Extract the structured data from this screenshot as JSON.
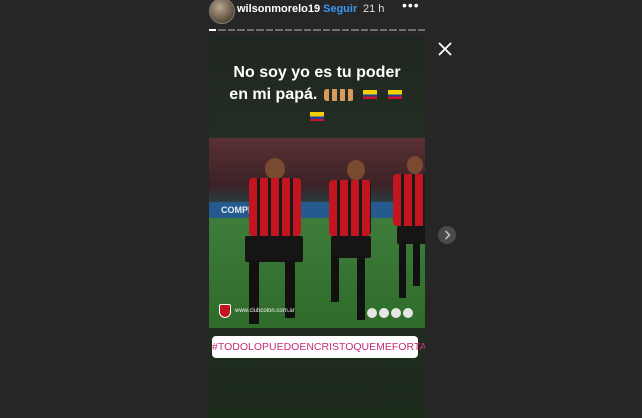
{
  "header": {
    "username": "wilsonmorelo19",
    "dot": "•",
    "follow_label": "Seguir",
    "time": "21 h",
    "more": "•••"
  },
  "story": {
    "caption_line1": "No soy yo es tu poder",
    "caption_line2": "en mi papá.",
    "banner_text": "COMPE",
    "site_text": "www.clubcolon.com.ar",
    "hashtag": "#TODOLOPUEDOENCRISTOQUEMEFORTALECE",
    "segments": 23,
    "active_segment": 1
  },
  "colors": {
    "accent": "#3897f0",
    "hashtag": "#c62a7a",
    "kit_red": "#c2151f"
  },
  "icons": {
    "close": "close-icon",
    "next": "chevron-right-icon",
    "more": "more-options-icon"
  }
}
